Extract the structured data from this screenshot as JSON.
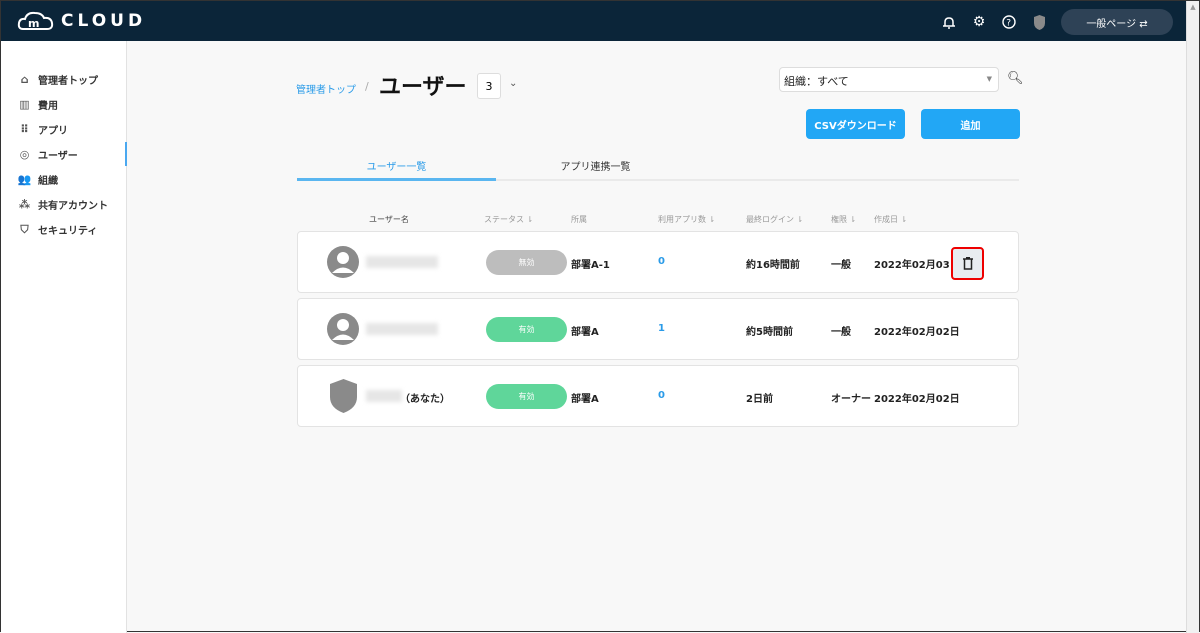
{
  "header": {
    "logo": "CLOUD",
    "switch_label": "一般ページ ⇄",
    "icons": [
      "bell-icon",
      "gear-icon",
      "help-icon",
      "shield-icon"
    ]
  },
  "sidebar": {
    "items": [
      {
        "label": "管理者トップ",
        "icon": "home-icon"
      },
      {
        "label": "費用",
        "icon": "chart-icon"
      },
      {
        "label": "アプリ",
        "icon": "grid-icon"
      },
      {
        "label": "ユーザー",
        "icon": "user-circle-icon",
        "active": true
      },
      {
        "label": "組織",
        "icon": "group-icon"
      },
      {
        "label": "共有アカウント",
        "icon": "shared-users-icon"
      },
      {
        "label": "セキュリティ",
        "icon": "shield-icon"
      }
    ]
  },
  "breadcrumb": {
    "parent": "管理者トップ",
    "separator": "/"
  },
  "page": {
    "title": "ユーザー",
    "count": "3"
  },
  "filter": {
    "org_value": "組織：すべて"
  },
  "buttons": {
    "csv": "CSVダウンロード",
    "add": "追加"
  },
  "tabs": [
    {
      "label": "ユーザー一覧",
      "active": true
    },
    {
      "label": "アプリ連携一覧"
    }
  ],
  "columns": [
    "ユーザー名",
    "ステータス ⇂",
    "所属",
    "利用アプリ数 ⇂",
    "最終ログイン ⇂",
    "権限 ⇂",
    "作成日 ⇂"
  ],
  "rows": [
    {
      "name_suffix": "",
      "status": "無効",
      "status_color": "#bdbdbd",
      "dept": "部署A-1",
      "apps": "0",
      "last_login": "約16時間前",
      "role": "一般",
      "created": "2022年02月03日",
      "avatar": "person",
      "highlight_delete": true
    },
    {
      "name_suffix": "",
      "status": "有効",
      "status_color": "#5fd69a",
      "dept": "部署A",
      "apps": "1",
      "last_login": "約5時間前",
      "role": "一般",
      "created": "2022年02月02日",
      "avatar": "person"
    },
    {
      "name_suffix": "（あなた）",
      "status": "有効",
      "status_color": "#5fd69a",
      "dept": "部署A",
      "apps": "0",
      "last_login": "2日前",
      "role": "オーナー",
      "created": "2022年02月02日",
      "avatar": "shield"
    }
  ],
  "colors": {
    "header": "#0b2539",
    "accent": "#22a7f5",
    "active": "#5fd69a",
    "inactive": "#bdbdbd"
  }
}
